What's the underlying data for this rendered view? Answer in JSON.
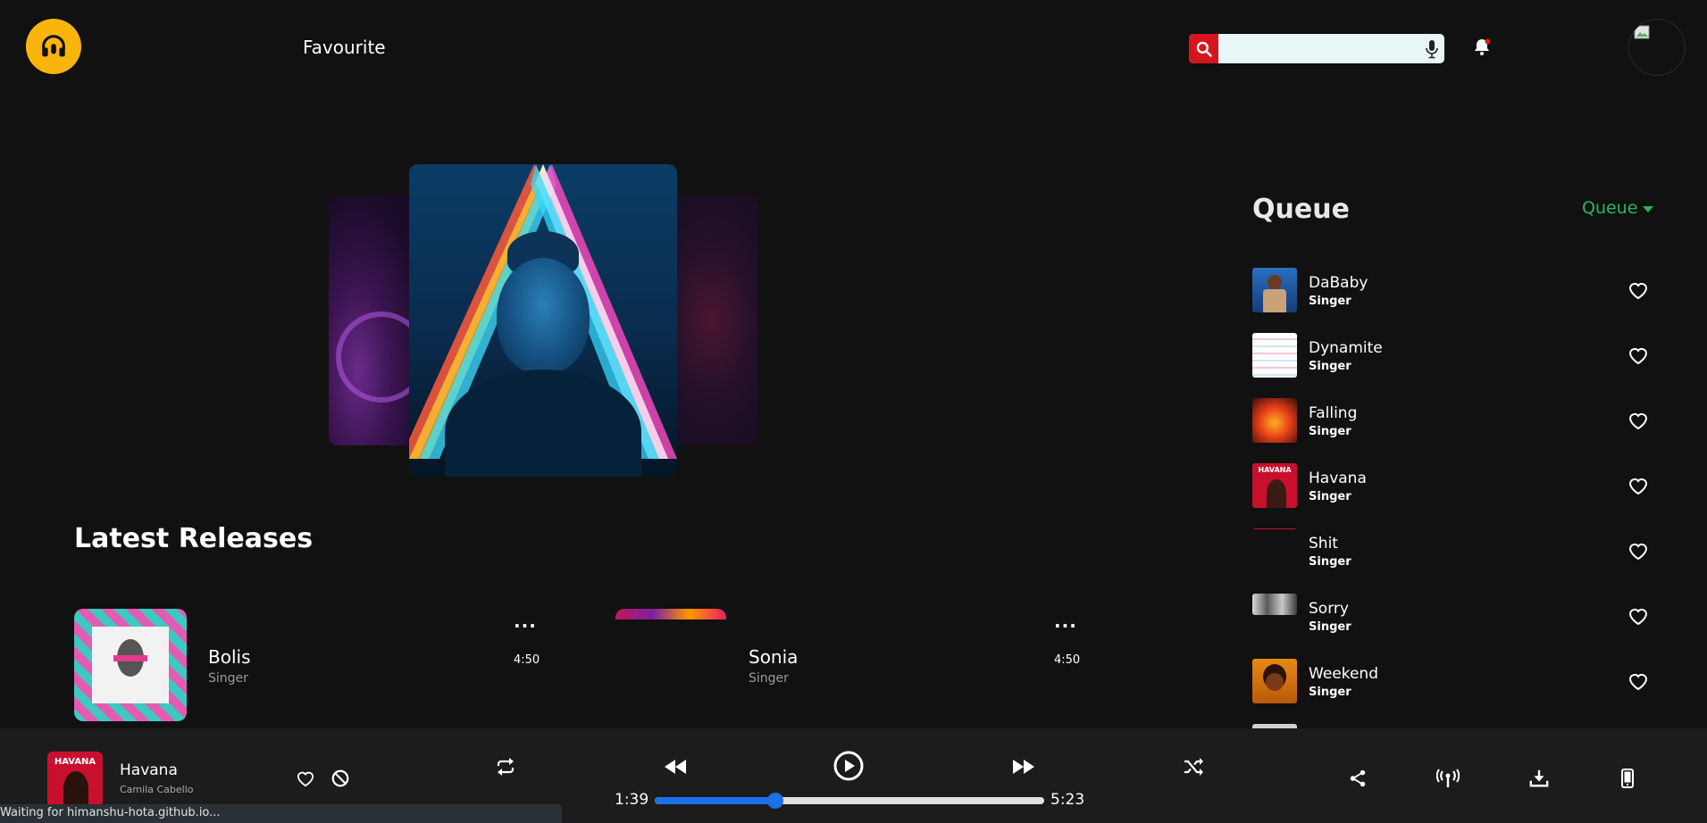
{
  "header": {
    "nav_title": "Favourite",
    "search_placeholder": ""
  },
  "latest_releases": {
    "title": "Latest Releases",
    "items": [
      {
        "name": "Bolis",
        "artist": "Singer",
        "menu": "...",
        "duration": "4:50"
      },
      {
        "name": "Sonia",
        "artist": "Singer",
        "menu": "...",
        "duration": "4:50"
      }
    ]
  },
  "queue": {
    "title": "Queue",
    "filter_label": "Queue",
    "items": [
      {
        "name": "DaBaby",
        "artist": "Singer"
      },
      {
        "name": "Dynamite",
        "artist": "Singer"
      },
      {
        "name": "Falling",
        "artist": "Singer"
      },
      {
        "name": "Havana",
        "artist": "Singer"
      },
      {
        "name": "Shit",
        "artist": "Singer"
      },
      {
        "name": "Sorry",
        "artist": "Singer"
      },
      {
        "name": "Weekend",
        "artist": "Singer"
      }
    ]
  },
  "player": {
    "title": "Havana",
    "artist": "Camila Cabello",
    "thumb_text": "HAVANA",
    "elapsed": "1:39",
    "total": "5:23",
    "progress_fraction": 0.31
  },
  "status_bar": "Waiting for himanshu-hota.github.io...",
  "colors": {
    "accent_red": "#d6161f",
    "logo_yellow": "#f9b50c",
    "queue_green": "#23b85c",
    "progress_blue": "#1a72e8"
  },
  "icons": [
    "headphones-icon",
    "search-icon",
    "mic-icon",
    "bell-icon",
    "heart-icon",
    "block-icon",
    "repeat-icon",
    "rewind-icon",
    "play-icon",
    "fast-forward-icon",
    "shuffle-icon",
    "share-icon",
    "broadcast-icon",
    "download-icon",
    "phone-icon"
  ]
}
